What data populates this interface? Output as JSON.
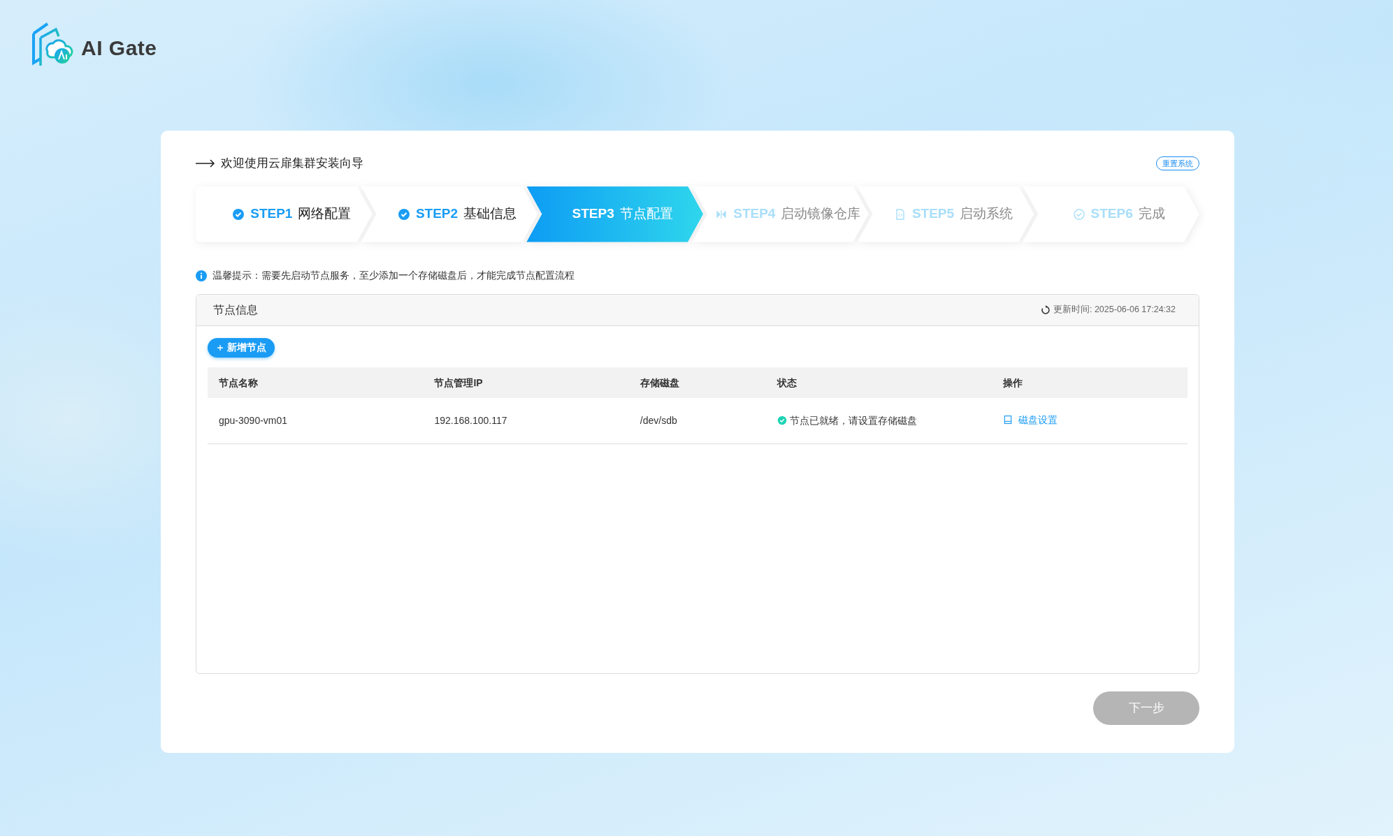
{
  "brand": {
    "name": "AI Gate"
  },
  "wizard": {
    "title": "欢迎使用云扉集群安装向导",
    "reset_button": "重置系统"
  },
  "steps": [
    {
      "number": "STEP1",
      "label": "网络配置",
      "completed": true,
      "selected": false
    },
    {
      "number": "STEP2",
      "label": "基础信息",
      "completed": true,
      "selected": false
    },
    {
      "number": "STEP3",
      "label": "节点配置",
      "completed": false,
      "selected": true
    },
    {
      "number": "STEP4",
      "label": "启动镜像仓库",
      "completed": false,
      "selected": false
    },
    {
      "number": "STEP5",
      "label": "启动系统",
      "completed": false,
      "selected": false
    },
    {
      "number": "STEP6",
      "label": "完成",
      "completed": false,
      "selected": false
    }
  ],
  "hint": "温馨提示：需要先启动节点服务，至少添加一个存储磁盘后，才能完成节点配置流程",
  "panel": {
    "title": "节点信息",
    "updated": "更新时间: 2025-06-06 17:24:32",
    "add_button": "新增节点"
  },
  "table": {
    "columns": [
      "节点名称",
      "节点管理IP",
      "存储磁盘",
      "状态",
      "操作"
    ],
    "rows": [
      {
        "name": "gpu-3090-vm01",
        "ip": "192.168.100.117",
        "disk": "/dev/sdb",
        "status": "节点已就绪，请设置存储磁盘",
        "ready": true,
        "action": "磁盘设置"
      }
    ]
  },
  "next_button": {
    "label": "下一步",
    "disabled": true
  }
}
